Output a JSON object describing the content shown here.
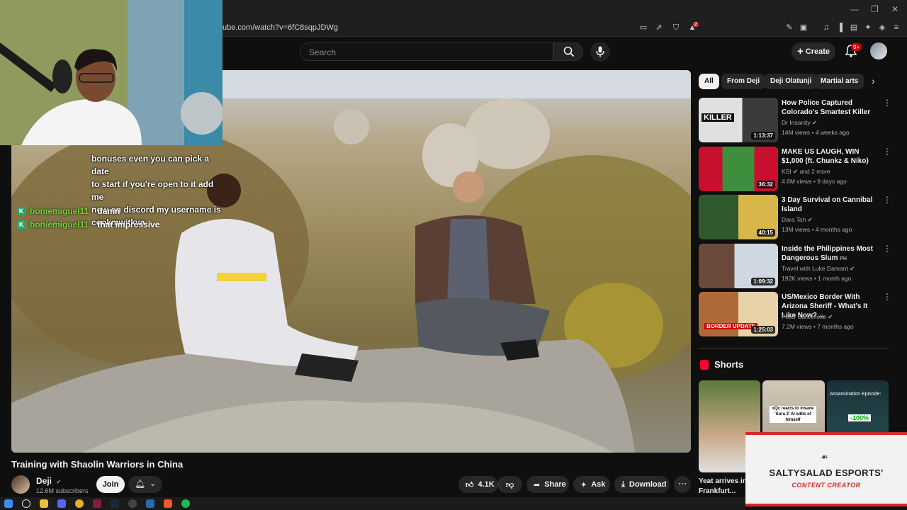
{
  "browser": {
    "url": "ube.com/watch?v=6fC8sqpJDWg",
    "badge_count": "2"
  },
  "header": {
    "search_placeholder": "Search",
    "create_label": "Create",
    "notif_badge": "9+"
  },
  "chat": {
    "lines": [
      "bonuses even you can pick a date",
      "to start if you're open to it add me",
      "now on discord my username is",
      "cookmwitkya"
    ],
    "messages": [
      {
        "badge": "K",
        "user": "boniemiguel11",
        "text": "damn"
      },
      {
        "badge": "K",
        "user": "boniemiguel11",
        "text": "that impressive"
      }
    ]
  },
  "video": {
    "title": "Training with Shaolin Warriors in China",
    "channel": "Deji",
    "subscribers": "12.6M subscribers",
    "join_label": "Join",
    "likes": "4.1K",
    "share_label": "Share",
    "ask_label": "Ask",
    "download_label": "Download"
  },
  "sidebar": {
    "chips": [
      "All",
      "From Deji",
      "Deji Olatunji",
      "Martial arts"
    ],
    "recommendations": [
      {
        "title": "How Police Captured Colorado's Smartest Killer",
        "channel": "Dr Insanity",
        "meta": "14M views • 4 weeks ago",
        "duration": "1:13:37",
        "thumb_text": "KILLER",
        "colors": [
          "#d8d8d8",
          "#3a3a3a"
        ]
      },
      {
        "title": "MAKE US LAUGH, WIN $1,000 (ft. Chunkz & Niko)",
        "channel": "KSI",
        "channel_extra": "and 2 more",
        "meta": "4.6M views • 9 days ago",
        "duration": "36:32",
        "colors": [
          "#c8102e",
          "#3e8e3e"
        ]
      },
      {
        "title": "3 Day Survival on Cannibal Island",
        "channel": "Dara Tah",
        "meta": "13M views • 4 months ago",
        "duration": "40:15",
        "colors": [
          "#2e5a2e",
          "#d9b64a"
        ]
      },
      {
        "title": "Inside the Philippines Most Dangerous Slum",
        "title_suffix": "PH",
        "channel": "Travel with Luke Damant",
        "meta": "192K views • 1 month ago",
        "duration": "1:09:32",
        "colors": [
          "#6a4a3a",
          "#cfd8e0"
        ]
      },
      {
        "title": "US/Mexico Border With Arizona Sheriff - What's It Like Now? ...",
        "channel": "Peter Santenello",
        "meta": "7.2M views • 7 months ago",
        "duration": "1:25:03",
        "thumb_text": "BORDER UPDATE",
        "colors": [
          "#b06a3a",
          "#e8d2a8"
        ]
      }
    ],
    "shorts_heading": "Shorts",
    "shorts": [
      {
        "title": "Yeat arrives in Frankfurt..."
      },
      {
        "caption": "xQc reacts to insane 'Sora 2' AI edits of himself"
      },
      {
        "caption": "Assassination Episode:",
        "tag": "-100%"
      }
    ]
  },
  "overlay": {
    "team_name": "SALTYSALAD ESPORTS'",
    "role": "CONTENT CREATOR"
  }
}
